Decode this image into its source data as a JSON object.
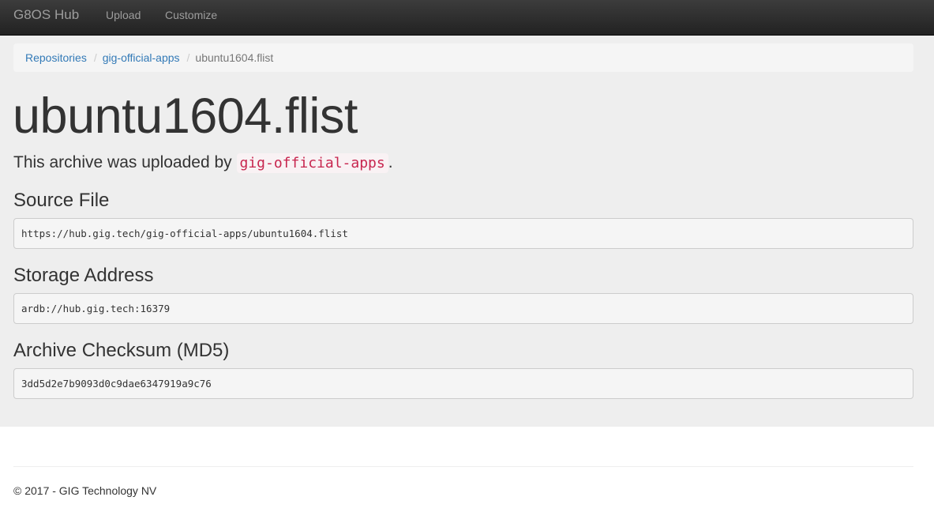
{
  "navbar": {
    "brand": "G8OS Hub",
    "links": [
      {
        "label": "Upload"
      },
      {
        "label": "Customize"
      }
    ]
  },
  "breadcrumb": {
    "items": [
      {
        "label": "Repositories"
      },
      {
        "label": "gig-official-apps"
      },
      {
        "label": "ubuntu1604.flist"
      }
    ],
    "separator": "/"
  },
  "page": {
    "title": "ubuntu1604.flist",
    "lead_prefix": "This archive was uploaded by ",
    "lead_user": "gig-official-apps",
    "lead_suffix": "."
  },
  "sections": {
    "source": {
      "heading": "Source File",
      "value": "https://hub.gig.tech/gig-official-apps/ubuntu1604.flist"
    },
    "storage": {
      "heading": "Storage Address",
      "value": "ardb://hub.gig.tech:16379"
    },
    "checksum": {
      "heading": "Archive Checksum (MD5)",
      "value": "3dd5d2e7b9093d0c9dae6347919a9c76"
    }
  },
  "footer": {
    "text": "© 2017 - GIG Technology NV"
  },
  "colors": {
    "navbar_bg": "#222222",
    "link": "#337ab7",
    "code": "#c7254e",
    "jumbotron_bg": "#eeeeee"
  }
}
